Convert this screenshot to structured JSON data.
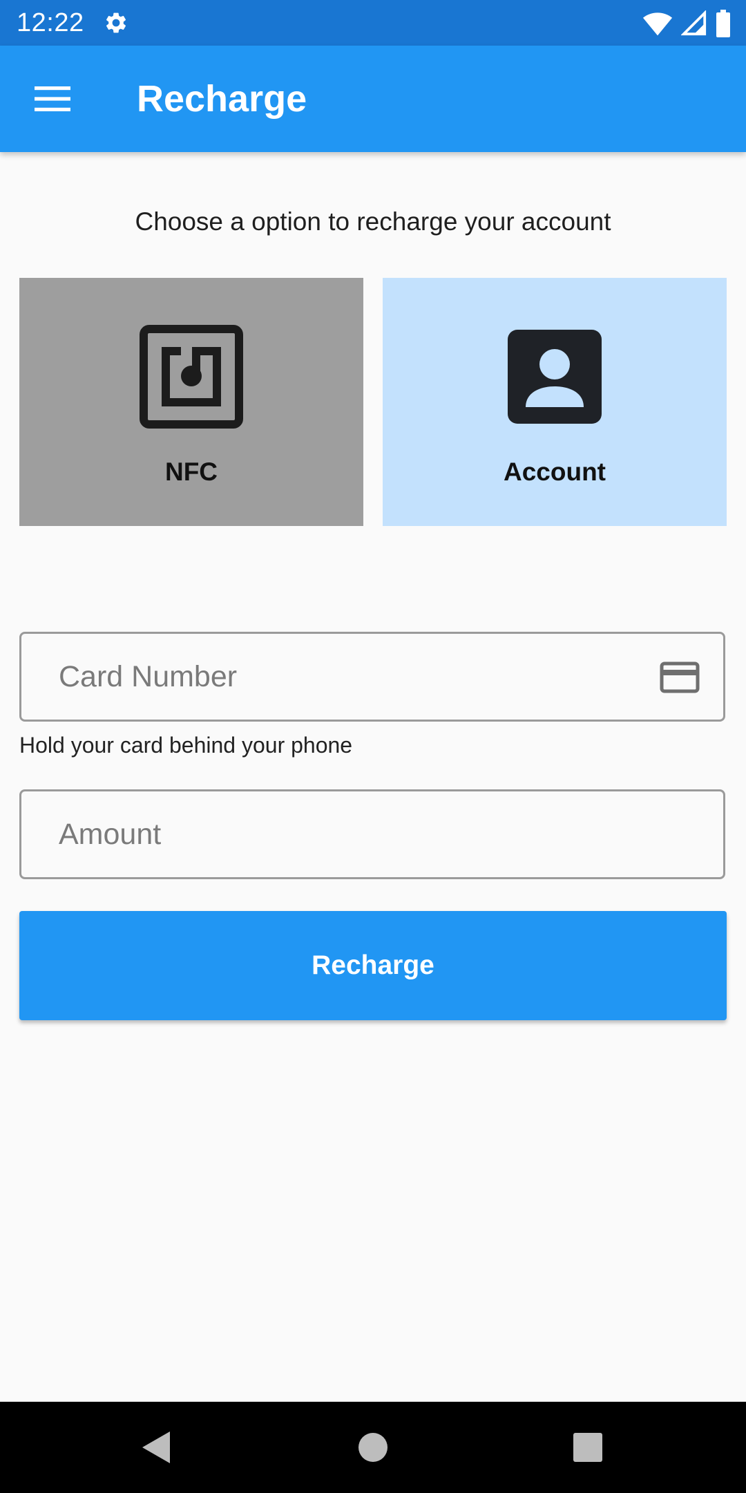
{
  "status_bar": {
    "time": "12:22",
    "icons": [
      "settings-gear-icon",
      "wifi-icon",
      "cellular-signal-icon",
      "battery-icon"
    ]
  },
  "app_bar": {
    "menu_icon": "hamburger-menu-icon",
    "title": "Recharge",
    "color": "#2196f3"
  },
  "main": {
    "prompt": "Choose a option to recharge your account",
    "options": [
      {
        "label": "NFC",
        "icon": "nfc-icon",
        "selected": true,
        "background": "#9e9e9e"
      },
      {
        "label": "Account",
        "icon": "account-box-icon",
        "selected": false,
        "background": "#c3e1fd"
      }
    ],
    "card_number": {
      "placeholder": "Card Number",
      "value": "",
      "icon": "credit-card-icon",
      "helper": "Hold your card behind your phone"
    },
    "amount": {
      "placeholder": "Amount",
      "value": ""
    },
    "recharge_button": "Recharge"
  },
  "nav_bar": {
    "buttons": [
      "back-icon",
      "home-icon",
      "recents-icon"
    ]
  }
}
